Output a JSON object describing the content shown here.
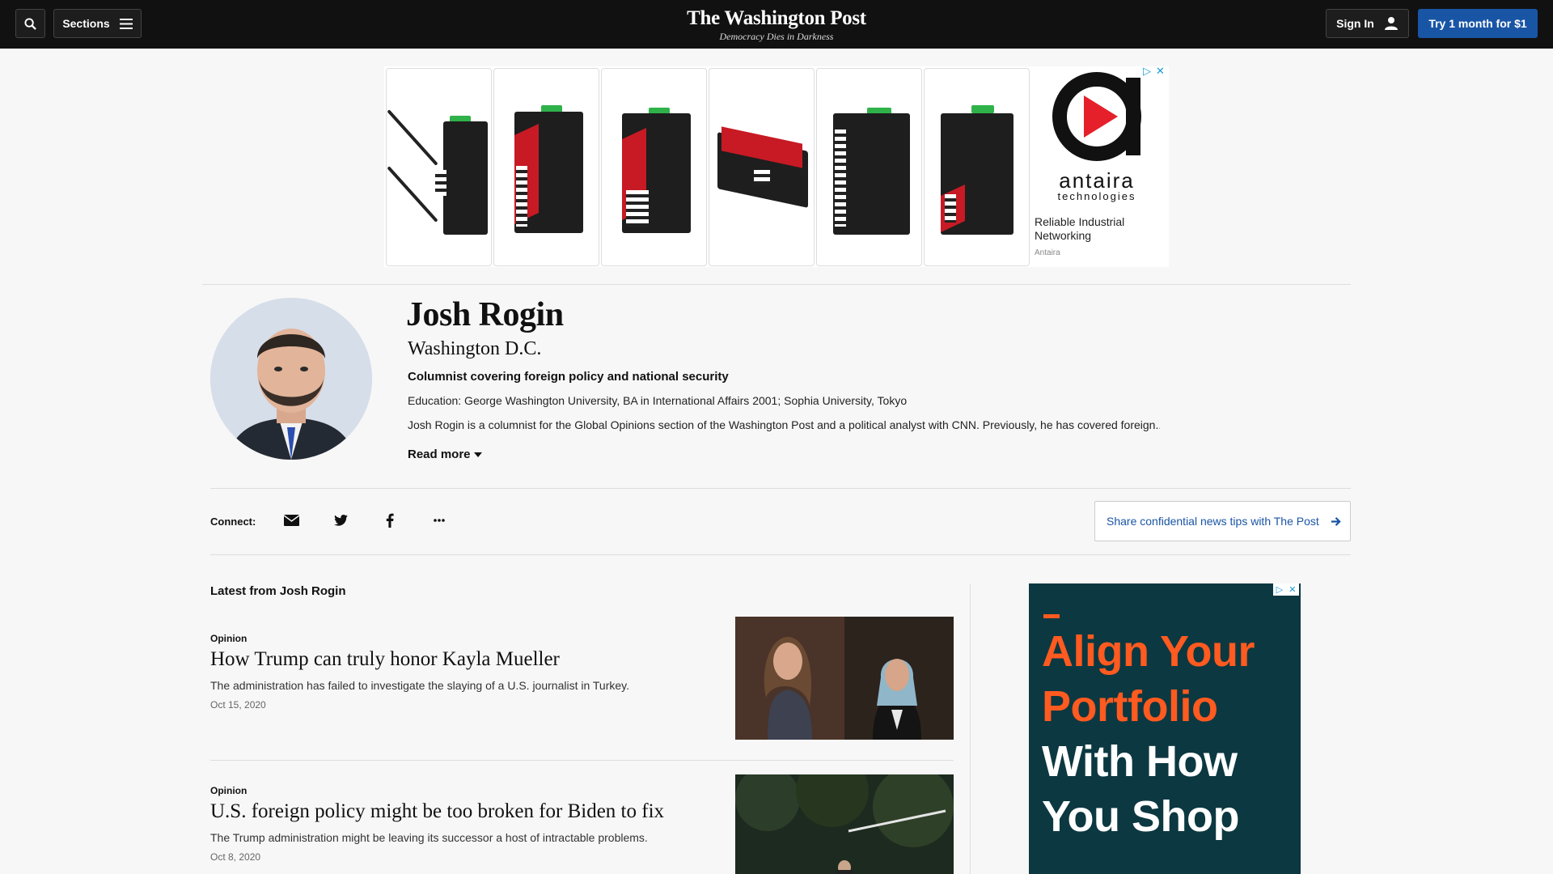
{
  "header": {
    "sections_label": "Sections",
    "logo": "The Washington Post",
    "tagline": "Democracy Dies in Darkness",
    "signin_label": "Sign In",
    "trial_label": "Try 1 month for $1"
  },
  "top_ad": {
    "brand_name": "antaira",
    "brand_sub": "technologies",
    "text": "Reliable Industrial Networking",
    "advertiser": "Antaira"
  },
  "profile": {
    "name": "Josh Rogin",
    "location": "Washington D.C.",
    "role": "Columnist covering foreign policy and national security",
    "education": "Education: George Washington University, BA in International Affairs 2001; Sophia University, Tokyo",
    "bio": "Josh Rogin is a columnist for the Global Opinions section of the Washington Post and a political analyst with CNN. Previously, he has covered foreign...",
    "read_more": "Read more"
  },
  "connect": {
    "label": "Connect:",
    "icons": [
      "email-icon",
      "twitter-icon",
      "facebook-icon",
      "more-icon"
    ],
    "tips_label": "Share confidential news tips with The Post"
  },
  "latest": {
    "title": "Latest from Josh Rogin",
    "articles": [
      {
        "kicker": "Opinion",
        "headline": "How Trump can truly honor Kayla Mueller",
        "blurb": "The administration has failed to investigate the slaying of a U.S. journalist in Turkey.",
        "date": "Oct 15, 2020"
      },
      {
        "kicker": "Opinion",
        "headline": "U.S. foreign policy might be too broken for Biden to fix",
        "blurb": "The Trump administration might be leaving its successor a host of intractable problems.",
        "date": "Oct 8, 2020"
      }
    ]
  },
  "right_ad": {
    "line1": "Align Your",
    "line2": "Portfolio",
    "line3": "With How",
    "line4": "You Shop"
  },
  "colors": {
    "header_bg": "#111111",
    "accent_blue": "#1955a5",
    "ad_teal": "#0c3841",
    "ad_orange": "#ff5a1f"
  }
}
